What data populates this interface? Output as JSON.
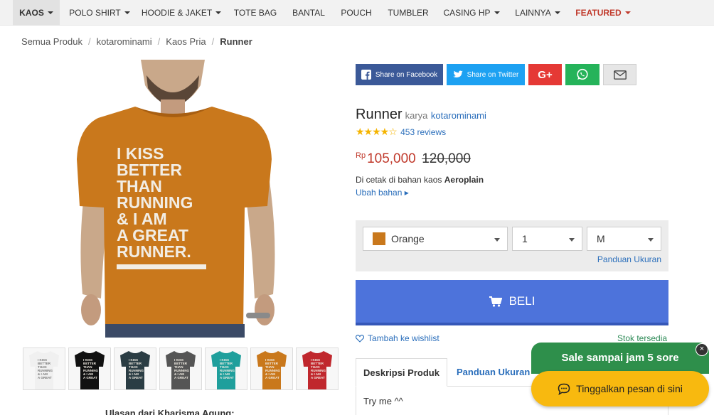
{
  "nav": {
    "items": [
      {
        "label": "KAOS"
      },
      {
        "label": "POLO SHIRT"
      },
      {
        "label": "HOODIE & JAKET"
      },
      {
        "label": "TOTE BAG"
      },
      {
        "label": "BANTAL"
      },
      {
        "label": "POUCH"
      },
      {
        "label": "TUMBLER"
      },
      {
        "label": "CASING HP"
      },
      {
        "label": "LAINNYA"
      },
      {
        "label": "FEATURED"
      }
    ]
  },
  "breadcrumb": {
    "items": [
      "Semua Produk",
      "kotarominami",
      "Kaos Pria"
    ],
    "current": "Runner",
    "separator": "/"
  },
  "product_image": {
    "shirt_text": [
      "I KISS",
      "BETTER",
      "THAN",
      "RUNNING",
      "& I AM",
      "A GREAT",
      "RUNNER."
    ],
    "shirt_color": "#c9781c"
  },
  "thumbnails": {
    "colors": [
      "#f0f0f0",
      "#111111",
      "#2b3d44",
      "#555555",
      "#1f9f9c",
      "#c9781c",
      "#c0272d"
    ],
    "mini_text": [
      "I KISS",
      "BETTER",
      "THAN",
      "RUNNING",
      "& I AM",
      "A GREAT",
      "RUNNER."
    ]
  },
  "bottom_caption": "Ulasan dari Kharisma Agung:",
  "share": {
    "facebook_label": "Share on Facebook",
    "twitter_label": "Share on Twitter",
    "gplus_label": "G+",
    "colors": {
      "facebook": "#3b5998",
      "twitter": "#1da1f2",
      "gplus": "#e53935",
      "whatsapp": "#25b35a",
      "email": "#e6e6e6"
    }
  },
  "product": {
    "name": "Runner",
    "by_label": "karya",
    "author": "kotarominami",
    "stars": "★★★★☆",
    "reviews": "453 reviews",
    "currency": "Rp",
    "price": "105,000",
    "old_price": "120,000",
    "material_prefix": "Di cetak di bahan kaos",
    "material_name": "Aeroplain",
    "change_material": "Ubah bahan ▸"
  },
  "options": {
    "color_value": "Orange",
    "color_swatch": "#c9781c",
    "quantity_value": "1",
    "size_value": "M",
    "size_guide_link": "Panduan Ukuran"
  },
  "buy": {
    "label": "BELI"
  },
  "wishlist_label": "Tambah ke wishlist",
  "stock_label": "Stok tersedia",
  "tabs": {
    "items": [
      {
        "label": "Deskripsi Produk"
      },
      {
        "label": "Panduan Ukuran"
      }
    ],
    "content": "Try me ^^"
  },
  "chat": {
    "banner": "Sale sampai jam 5 sore",
    "button": "Tinggalkan pesan di sini",
    "close": "×"
  }
}
